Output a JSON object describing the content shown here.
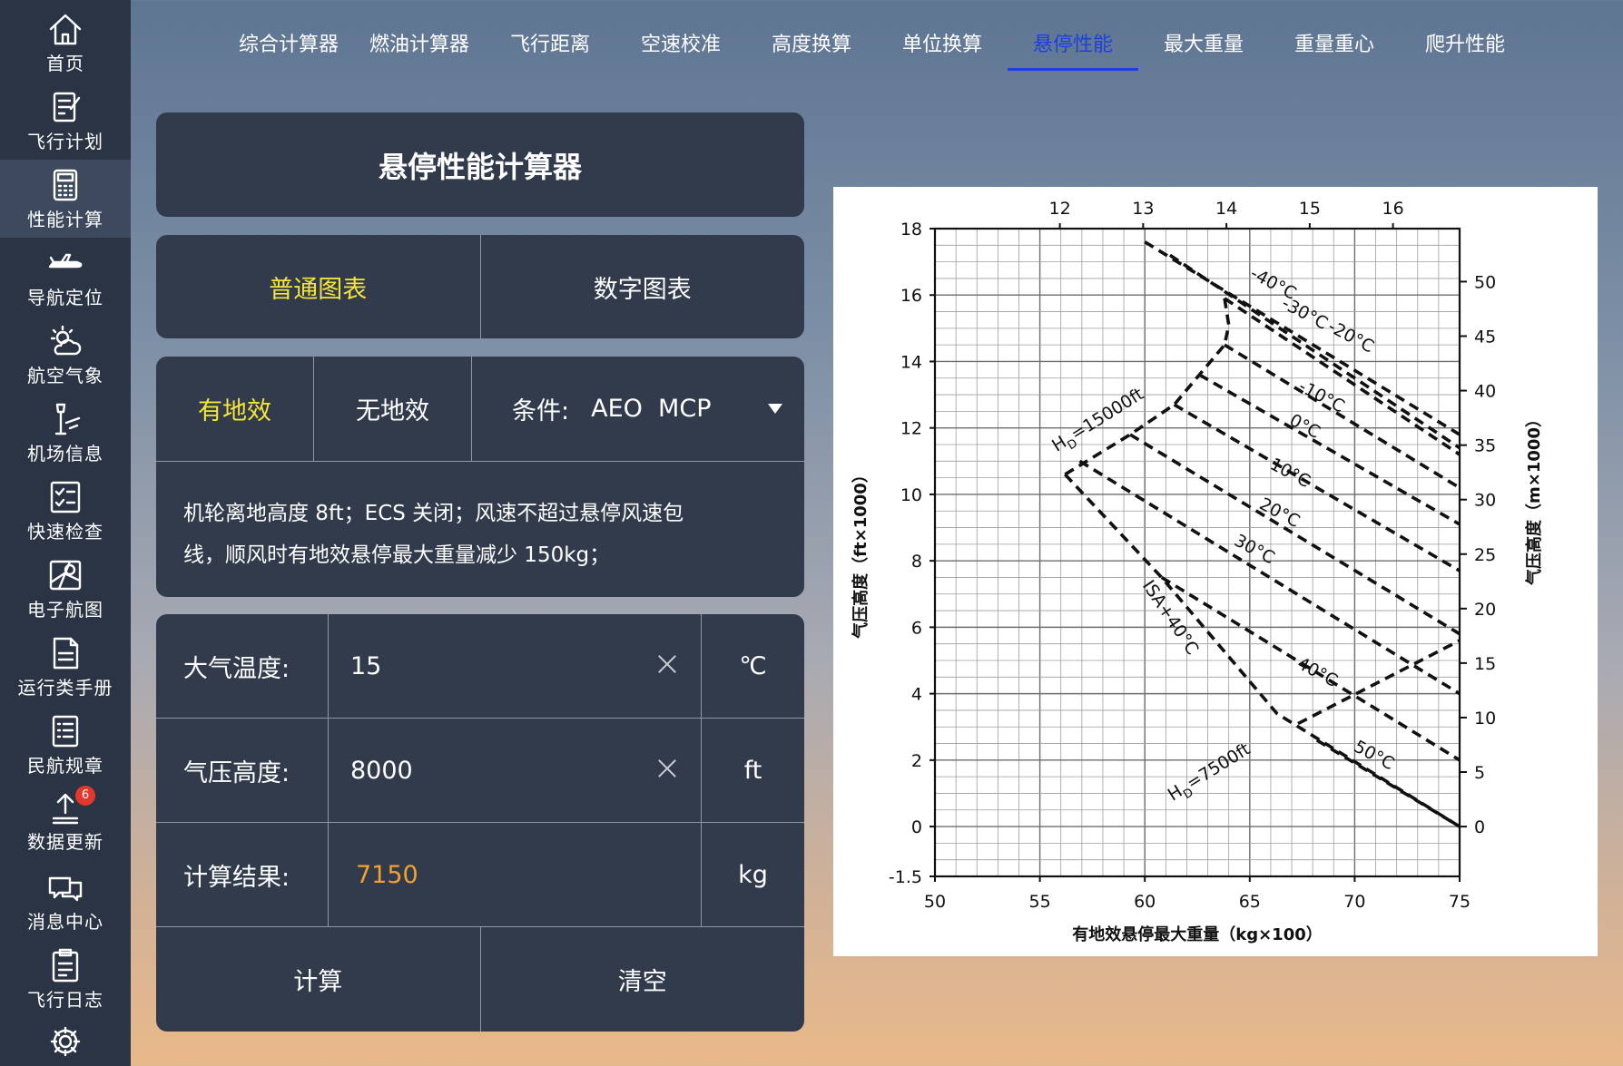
{
  "sidebar": {
    "items": [
      {
        "label": "首页",
        "icon": "home-icon"
      },
      {
        "label": "飞行计划",
        "icon": "flight-plan-icon"
      },
      {
        "label": "性能计算",
        "icon": "calculator-icon",
        "active": true
      },
      {
        "label": "导航定位",
        "icon": "airplane-icon"
      },
      {
        "label": "航空气象",
        "icon": "weather-icon"
      },
      {
        "label": "机场信息",
        "icon": "airport-icon"
      },
      {
        "label": "快速检查",
        "icon": "checklist-icon"
      },
      {
        "label": "电子航图",
        "icon": "map-icon"
      },
      {
        "label": "运行类手册",
        "icon": "manual-icon"
      },
      {
        "label": "民航规章",
        "icon": "regulation-icon"
      },
      {
        "label": "数据更新",
        "icon": "update-icon",
        "badge": "6"
      },
      {
        "label": "消息中心",
        "icon": "message-icon"
      },
      {
        "label": "飞行日志",
        "icon": "logbook-icon"
      },
      {
        "label": "",
        "icon": "gear-icon"
      }
    ]
  },
  "tabs": [
    {
      "label": "综合计算器"
    },
    {
      "label": "燃油计算器"
    },
    {
      "label": "飞行距离"
    },
    {
      "label": "空速校准"
    },
    {
      "label": "高度换算"
    },
    {
      "label": "单位换算"
    },
    {
      "label": "悬停性能",
      "active": true
    },
    {
      "label": "最大重量"
    },
    {
      "label": "重量重心"
    },
    {
      "label": "爬升性能"
    }
  ],
  "calculator": {
    "title": "悬停性能计算器",
    "chart_modes": {
      "normal": "普通图表",
      "digital": "数字图表",
      "selected": "普通图表"
    },
    "ground_effect": {
      "with": "有地效",
      "without": "无地效",
      "selected": "有地效"
    },
    "condition_label": "条件:",
    "condition_value": "AEO  MCP",
    "note_line1": "机轮离地高度 8ft；ECS 关闭；风速不超过悬停风速包",
    "note_line2": "线，顺风时有地效悬停最大重量减少 150kg；",
    "fields": [
      {
        "label": "大气温度:",
        "value": "15",
        "unit": "℃"
      },
      {
        "label": "气压高度:",
        "value": "8000",
        "unit": "ft"
      },
      {
        "label": "计算结果:",
        "value": "7150",
        "unit": "kg"
      }
    ],
    "calc_button": "计算",
    "clear_button": "清空"
  },
  "chart_data": {
    "type": "line",
    "title": "",
    "xlabel": "有地效悬停最大重量（kg×100）",
    "ylabel": "气压高度（ft×1000）",
    "y2label": "气压高度（m×1000）",
    "xlim": [
      50,
      75
    ],
    "ylim": [
      -1.5,
      18
    ],
    "x_ticks": [
      50,
      55,
      60,
      65,
      70,
      75
    ],
    "y_ticks": [
      -1.5,
      0,
      2,
      4,
      6,
      8,
      10,
      12,
      14,
      16,
      18
    ],
    "top_ticks": [
      12,
      13,
      14,
      15,
      16
    ],
    "right_ticks": [
      0,
      5,
      10,
      15,
      20,
      25,
      30,
      35,
      40,
      45,
      50
    ],
    "grid": true,
    "series": [
      {
        "name": "-40℃",
        "x": [
          60,
          75
        ],
        "y": [
          17.6,
          11.8
        ]
      },
      {
        "name": "-30℃",
        "x": [
          61.2,
          75
        ],
        "y": [
          17.2,
          11.4
        ]
      },
      {
        "name": "-20℃",
        "x": [
          63.8,
          75
        ],
        "y": [
          15.9,
          11.2
        ]
      },
      {
        "name": "-10℃",
        "x": [
          63.8,
          75
        ],
        "y": [
          14.5,
          10.2
        ]
      },
      {
        "name": "0℃",
        "x": [
          62.6,
          75
        ],
        "y": [
          13.6,
          9.1
        ]
      },
      {
        "name": "10℃",
        "x": [
          61.4,
          75
        ],
        "y": [
          12.7,
          7.7
        ]
      },
      {
        "name": "20℃",
        "x": [
          59.3,
          75
        ],
        "y": [
          11.8,
          5.8
        ]
      },
      {
        "name": "30℃",
        "x": [
          56.9,
          75
        ],
        "y": [
          11.0,
          4.0
        ]
      },
      {
        "name": "40℃",
        "x": [
          60.8,
          75
        ],
        "y": [
          7.5,
          2.0
        ]
      },
      {
        "name": "50℃",
        "x": [
          68.2,
          75
        ],
        "y": [
          2.6,
          0
        ]
      },
      {
        "name": "ISA+40℃",
        "x": [
          56.2,
          60.8,
          66.3,
          75
        ],
        "y": [
          10.6,
          7.5,
          3.4,
          0
        ]
      },
      {
        "name": "HD=15000ft",
        "x": [
          56.2,
          59.3,
          61.4,
          62.6,
          63.8,
          64.0,
          63.8
        ],
        "y": [
          10.6,
          11.8,
          12.7,
          13.6,
          14.5,
          15.1,
          15.9
        ]
      },
      {
        "name": "HD=7500ft",
        "x": [
          67.3,
          75
        ],
        "y": [
          3.1,
          5.6
        ]
      }
    ],
    "annotations": [
      {
        "text": "-40°C",
        "x": 66.0,
        "y": 16.2
      },
      {
        "text": "-30°C",
        "x": 67.5,
        "y": 15.3
      },
      {
        "text": "-20°C",
        "x": 69.7,
        "y": 14.6
      },
      {
        "text": "-10°C",
        "x": 68.3,
        "y": 12.8
      },
      {
        "text": "0°C",
        "x": 67.5,
        "y": 11.9
      },
      {
        "text": "10°C",
        "x": 66.8,
        "y": 10.5
      },
      {
        "text": "20°C",
        "x": 66.3,
        "y": 9.3
      },
      {
        "text": "30°C",
        "x": 65.1,
        "y": 8.2
      },
      {
        "text": "40°C",
        "x": 68.1,
        "y": 4.5
      },
      {
        "text": "50°C",
        "x": 70.8,
        "y": 2.0
      },
      {
        "text": "ISA+40°C",
        "x": 61.0,
        "y": 6.2
      },
      {
        "text": "H",
        "sub": "D",
        "rest": "=15000ft",
        "x": 57.9,
        "y": 12.1
      },
      {
        "text": "H",
        "sub": "D",
        "rest": "=7500ft",
        "x": 63.2,
        "y": 1.5
      }
    ]
  }
}
